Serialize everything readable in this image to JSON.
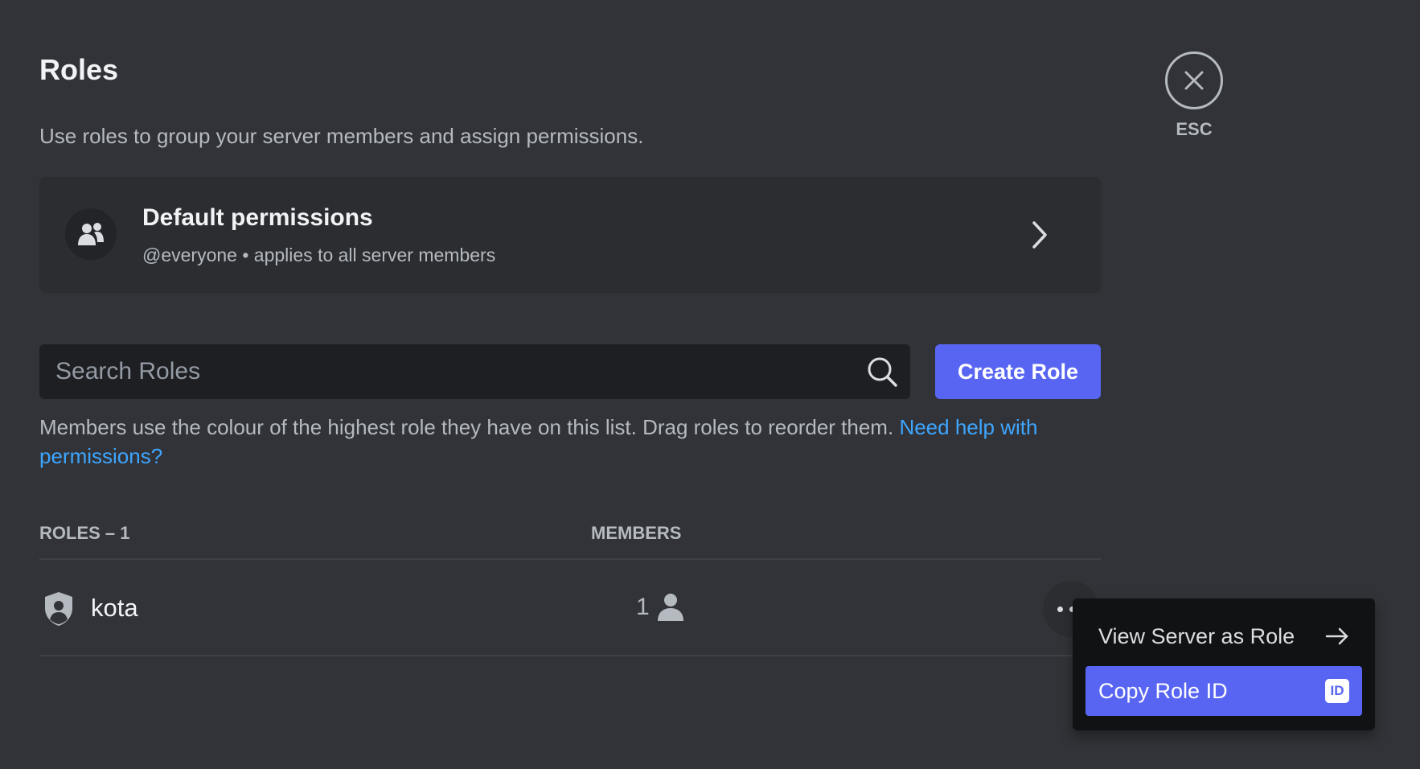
{
  "header": {
    "title": "Roles",
    "subtitle": "Use roles to group your server members and assign permissions."
  },
  "close": {
    "icon": "close-icon",
    "label": "ESC"
  },
  "default_permissions": {
    "icon": "members-icon",
    "title": "Default permissions",
    "subtitle": "@everyone • applies to all server members"
  },
  "search": {
    "placeholder": "Search Roles",
    "value": ""
  },
  "create_role_label": "Create Role",
  "info": {
    "text": "Members use the colour of the highest role they have on this list. Drag roles to reorder them.",
    "link": "Need help with permissions?"
  },
  "table": {
    "roles_header": "ROLES – 1",
    "members_header": "MEMBERS",
    "rows": [
      {
        "name": "kota",
        "members": "1"
      }
    ]
  },
  "context_menu": {
    "items": [
      {
        "label": "View Server as Role",
        "icon": "arrow-right-icon"
      },
      {
        "label": "Copy Role ID",
        "icon": "id-icon",
        "badge": "ID"
      }
    ]
  },
  "colors": {
    "background": "#313338",
    "card": "#2b2d31",
    "input": "#1e1f22",
    "accent": "#5865f2",
    "link": "#3ea6ff",
    "menu": "#111214"
  }
}
